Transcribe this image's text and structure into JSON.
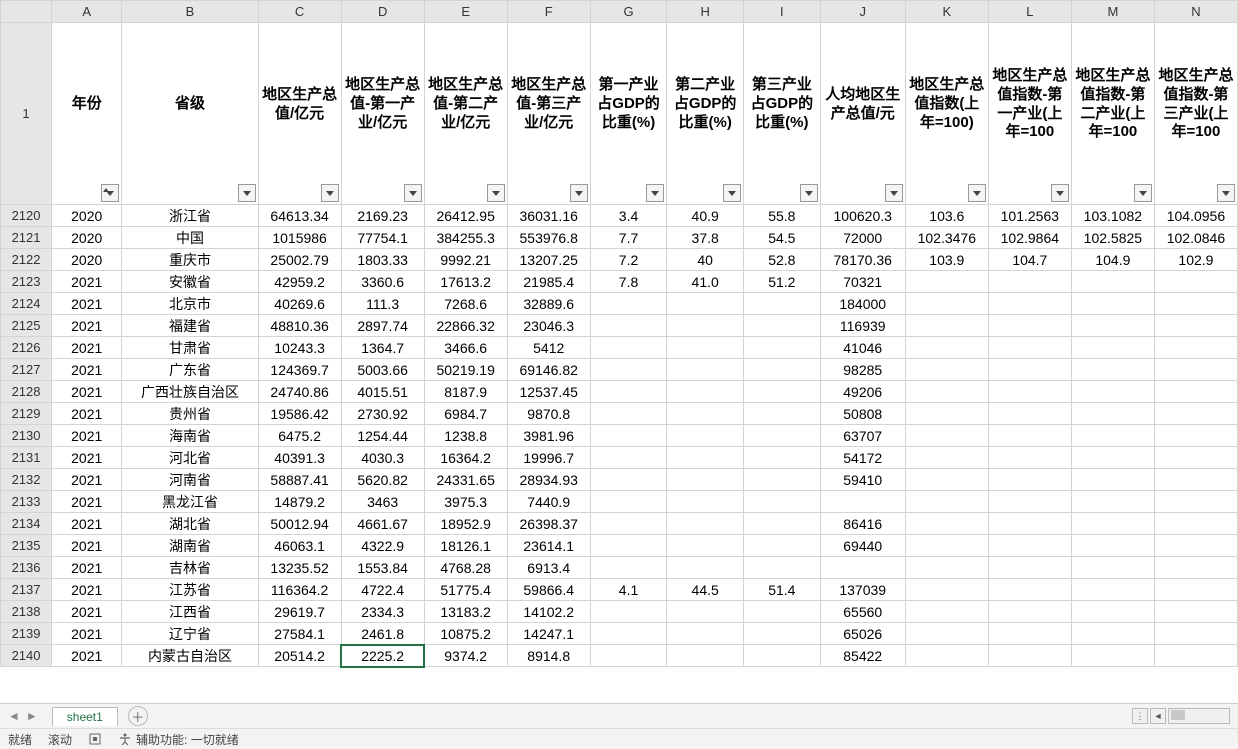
{
  "columns": [
    "A",
    "B",
    "C",
    "D",
    "E",
    "F",
    "G",
    "H",
    "I",
    "J",
    "K",
    "L",
    "M",
    "N"
  ],
  "selected_column_letter": "D",
  "selected_cell": {
    "row": 2140,
    "col": "D"
  },
  "headers": {
    "A": "年份",
    "B": "省级",
    "C": "地区生产总值/亿元",
    "D": "地区生产总值-第一产业/亿元",
    "E": "地区生产总值-第二产业/亿元",
    "F": "地区生产总值-第三产业/亿元",
    "G": "第一产业占GDP的比重(%)",
    "H": "第二产业占GDP的比重(%)",
    "I": "第三产业占GDP的比重(%)",
    "J": "人均地区生产总值/元",
    "K": "地区生产总值指数(上年=100)",
    "L": "地区生产总值指数-第一产业(上年=100)",
    "M": "地区生产总值指数-第二产业(上年=100)",
    "N": "地区生产总值指数-第三产业(上年=100)"
  },
  "header_display_overrides": {
    "L": "地区生产总值指数-第一产业(上年=100",
    "M": "地区生产总值指数-第二产业(上年=100",
    "N": "地区生产总值指数-第三产业(上年=100"
  },
  "filter_sorted_column": "A",
  "header_row_number": 1,
  "rows": [
    {
      "n": 2120,
      "A": "2020",
      "B": "浙江省",
      "C": "64613.34",
      "D": "2169.23",
      "E": "26412.95",
      "F": "36031.16",
      "G": "3.4",
      "H": "40.9",
      "I": "55.8",
      "J": "100620.3",
      "K": "103.6",
      "L": "101.2563",
      "M": "103.1082",
      "N": "104.0956"
    },
    {
      "n": 2121,
      "A": "2020",
      "B": "中国",
      "C": "1015986",
      "D": "77754.1",
      "E": "384255.3",
      "F": "553976.8",
      "G": "7.7",
      "H": "37.8",
      "I": "54.5",
      "J": "72000",
      "K": "102.3476",
      "L": "102.9864",
      "M": "102.5825",
      "N": "102.0846"
    },
    {
      "n": 2122,
      "A": "2020",
      "B": "重庆市",
      "C": "25002.79",
      "D": "1803.33",
      "E": "9992.21",
      "F": "13207.25",
      "G": "7.2",
      "H": "40",
      "I": "52.8",
      "J": "78170.36",
      "K": "103.9",
      "L": "104.7",
      "M": "104.9",
      "N": "102.9"
    },
    {
      "n": 2123,
      "A": "2021",
      "B": "安徽省",
      "C": "42959.2",
      "D": "3360.6",
      "E": "17613.2",
      "F": "21985.4",
      "G": "7.8",
      "H": "41.0",
      "I": "51.2",
      "J": "70321",
      "K": "",
      "L": "",
      "M": "",
      "N": ""
    },
    {
      "n": 2124,
      "A": "2021",
      "B": "北京市",
      "C": "40269.6",
      "D": "111.3",
      "E": "7268.6",
      "F": "32889.6",
      "G": "",
      "H": "",
      "I": "",
      "J": "184000",
      "K": "",
      "L": "",
      "M": "",
      "N": ""
    },
    {
      "n": 2125,
      "A": "2021",
      "B": "福建省",
      "C": "48810.36",
      "D": "2897.74",
      "E": "22866.32",
      "F": "23046.3",
      "G": "",
      "H": "",
      "I": "",
      "J": "116939",
      "K": "",
      "L": "",
      "M": "",
      "N": ""
    },
    {
      "n": 2126,
      "A": "2021",
      "B": "甘肃省",
      "C": "10243.3",
      "D": "1364.7",
      "E": "3466.6",
      "F": "5412",
      "G": "",
      "H": "",
      "I": "",
      "J": "41046",
      "K": "",
      "L": "",
      "M": "",
      "N": ""
    },
    {
      "n": 2127,
      "A": "2021",
      "B": "广东省",
      "C": "124369.7",
      "D": "5003.66",
      "E": "50219.19",
      "F": "69146.82",
      "G": "",
      "H": "",
      "I": "",
      "J": "98285",
      "K": "",
      "L": "",
      "M": "",
      "N": ""
    },
    {
      "n": 2128,
      "A": "2021",
      "B": "广西壮族自治区",
      "C": "24740.86",
      "D": "4015.51",
      "E": "8187.9",
      "F": "12537.45",
      "G": "",
      "H": "",
      "I": "",
      "J": "49206",
      "K": "",
      "L": "",
      "M": "",
      "N": ""
    },
    {
      "n": 2129,
      "A": "2021",
      "B": "贵州省",
      "C": "19586.42",
      "D": "2730.92",
      "E": "6984.7",
      "F": "9870.8",
      "G": "",
      "H": "",
      "I": "",
      "J": "50808",
      "K": "",
      "L": "",
      "M": "",
      "N": ""
    },
    {
      "n": 2130,
      "A": "2021",
      "B": "海南省",
      "C": "6475.2",
      "D": "1254.44",
      "E": "1238.8",
      "F": "3981.96",
      "G": "",
      "H": "",
      "I": "",
      "J": "63707",
      "K": "",
      "L": "",
      "M": "",
      "N": ""
    },
    {
      "n": 2131,
      "A": "2021",
      "B": "河北省",
      "C": "40391.3",
      "D": "4030.3",
      "E": "16364.2",
      "F": "19996.7",
      "G": "",
      "H": "",
      "I": "",
      "J": "54172",
      "K": "",
      "L": "",
      "M": "",
      "N": ""
    },
    {
      "n": 2132,
      "A": "2021",
      "B": "河南省",
      "C": "58887.41",
      "D": "5620.82",
      "E": "24331.65",
      "F": "28934.93",
      "G": "",
      "H": "",
      "I": "",
      "J": "59410",
      "K": "",
      "L": "",
      "M": "",
      "N": ""
    },
    {
      "n": 2133,
      "A": "2021",
      "B": "黑龙江省",
      "C": "14879.2",
      "D": "3463",
      "E": "3975.3",
      "F": "7440.9",
      "G": "",
      "H": "",
      "I": "",
      "J": "",
      "K": "",
      "L": "",
      "M": "",
      "N": ""
    },
    {
      "n": 2134,
      "A": "2021",
      "B": "湖北省",
      "C": "50012.94",
      "D": "4661.67",
      "E": "18952.9",
      "F": "26398.37",
      "G": "",
      "H": "",
      "I": "",
      "J": "86416",
      "K": "",
      "L": "",
      "M": "",
      "N": ""
    },
    {
      "n": 2135,
      "A": "2021",
      "B": "湖南省",
      "C": "46063.1",
      "D": "4322.9",
      "E": "18126.1",
      "F": "23614.1",
      "G": "",
      "H": "",
      "I": "",
      "J": "69440",
      "K": "",
      "L": "",
      "M": "",
      "N": ""
    },
    {
      "n": 2136,
      "A": "2021",
      "B": "吉林省",
      "C": "13235.52",
      "D": "1553.84",
      "E": "4768.28",
      "F": "6913.4",
      "G": "",
      "H": "",
      "I": "",
      "J": "",
      "K": "",
      "L": "",
      "M": "",
      "N": ""
    },
    {
      "n": 2137,
      "A": "2021",
      "B": "江苏省",
      "C": "116364.2",
      "D": "4722.4",
      "E": "51775.4",
      "F": "59866.4",
      "G": "4.1",
      "H": "44.5",
      "I": "51.4",
      "J": "137039",
      "K": "",
      "L": "",
      "M": "",
      "N": ""
    },
    {
      "n": 2138,
      "A": "2021",
      "B": "江西省",
      "C": "29619.7",
      "D": "2334.3",
      "E": "13183.2",
      "F": "14102.2",
      "G": "",
      "H": "",
      "I": "",
      "J": "65560",
      "K": "",
      "L": "",
      "M": "",
      "N": ""
    },
    {
      "n": 2139,
      "A": "2021",
      "B": "辽宁省",
      "C": "27584.1",
      "D": "2461.8",
      "E": "10875.2",
      "F": "14247.1",
      "G": "",
      "H": "",
      "I": "",
      "J": "65026",
      "K": "",
      "L": "",
      "M": "",
      "N": ""
    },
    {
      "n": 2140,
      "A": "2021",
      "B": "内蒙古自治区",
      "C": "20514.2",
      "D": "2225.2",
      "E": "9374.2",
      "F": "8914.8",
      "G": "",
      "H": "",
      "I": "",
      "J": "85422",
      "K": "",
      "L": "",
      "M": "",
      "N": ""
    }
  ],
  "sheet_tab": "sheet1",
  "statusbar": {
    "ready": "就绪",
    "scroll": "滚动",
    "accessibility_label": "辅助功能: 一切就绪"
  }
}
